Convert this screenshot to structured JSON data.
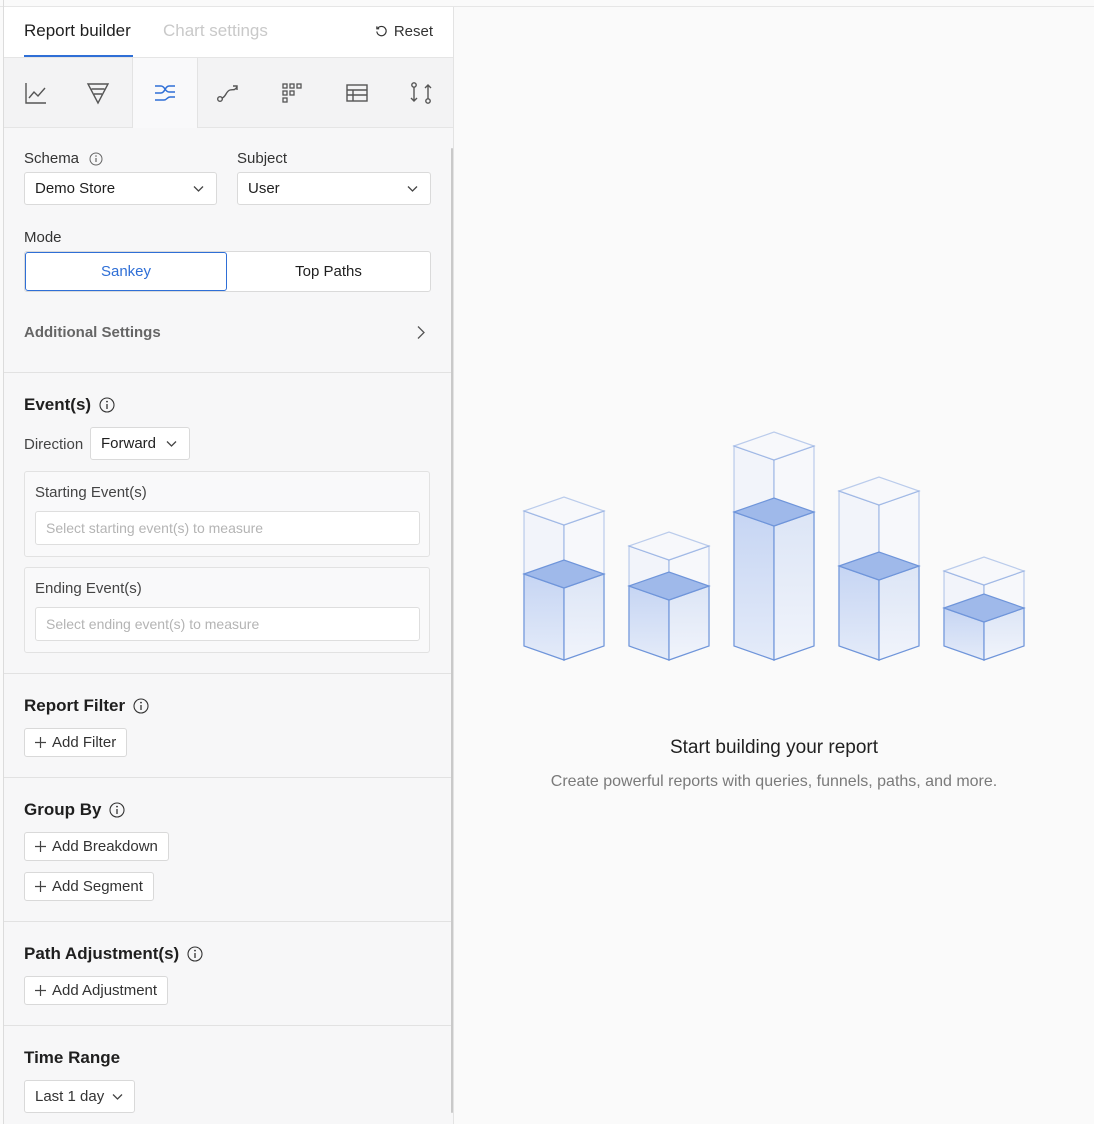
{
  "header": {
    "tabs": [
      {
        "label": "Report builder",
        "active": true
      },
      {
        "label": "Chart settings",
        "active": false
      }
    ],
    "reset_label": "Reset"
  },
  "chart_types": [
    {
      "name": "line-chart-icon",
      "active": false
    },
    {
      "name": "funnel-icon",
      "active": false
    },
    {
      "name": "flows-icon",
      "active": true
    },
    {
      "name": "path-icon",
      "active": false
    },
    {
      "name": "grid-icon",
      "active": false
    },
    {
      "name": "table-icon",
      "active": false
    },
    {
      "name": "compare-icon",
      "active": false
    }
  ],
  "schema": {
    "label": "Schema",
    "value": "Demo Store"
  },
  "subject": {
    "label": "Subject",
    "value": "User"
  },
  "mode": {
    "label": "Mode",
    "options": [
      "Sankey",
      "Top Paths"
    ],
    "selected": "Sankey"
  },
  "additional_settings": "Additional Settings",
  "events": {
    "title": "Event(s)",
    "direction_label": "Direction",
    "direction_value": "Forward",
    "starting": {
      "label": "Starting Event(s)",
      "placeholder": "Select starting event(s) to measure"
    },
    "ending": {
      "label": "Ending Event(s)",
      "placeholder": "Select ending event(s) to measure"
    }
  },
  "report_filter": {
    "title": "Report Filter",
    "button": "Add Filter"
  },
  "group_by": {
    "title": "Group By",
    "breakdown_button": "Add Breakdown",
    "segment_button": "Add Segment"
  },
  "path_adjustments": {
    "title": "Path Adjustment(s)",
    "button": "Add Adjustment"
  },
  "time_range": {
    "title": "Time Range",
    "value": "Last 1 day"
  },
  "empty_state": {
    "title": "Start building your report",
    "subtitle": "Create powerful reports with queries, funnels, paths, and more."
  },
  "colors": {
    "accent": "#2f6fd6",
    "illustration": "#7b9fe0"
  }
}
